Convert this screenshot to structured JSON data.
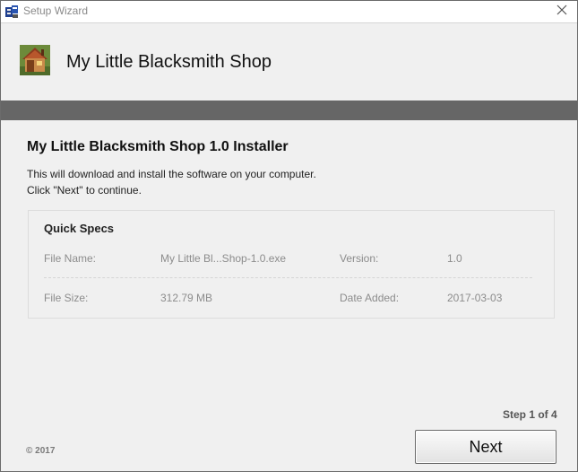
{
  "window": {
    "title": "Setup Wizard",
    "close_icon": "close-icon",
    "app_icon": "setup-app-icon"
  },
  "header": {
    "product_name": "My Little Blacksmith Shop",
    "product_icon": "house-icon"
  },
  "content": {
    "installer_title": "My Little Blacksmith Shop 1.0 Installer",
    "description_line1": "This will download and install the software on your computer.",
    "description_line2": "Click \"Next\" to continue."
  },
  "quick_specs": {
    "title": "Quick Specs",
    "file_name_label": "File Name:",
    "file_name_value": "My Little Bl...Shop-1.0.exe",
    "version_label": "Version:",
    "version_value": "1.0",
    "file_size_label": "File Size:",
    "file_size_value": "312.79 MB",
    "date_added_label": "Date Added:",
    "date_added_value": "2017-03-03"
  },
  "footer": {
    "step": "Step 1 of 4",
    "copyright": "© 2017",
    "next_label": "Next"
  }
}
